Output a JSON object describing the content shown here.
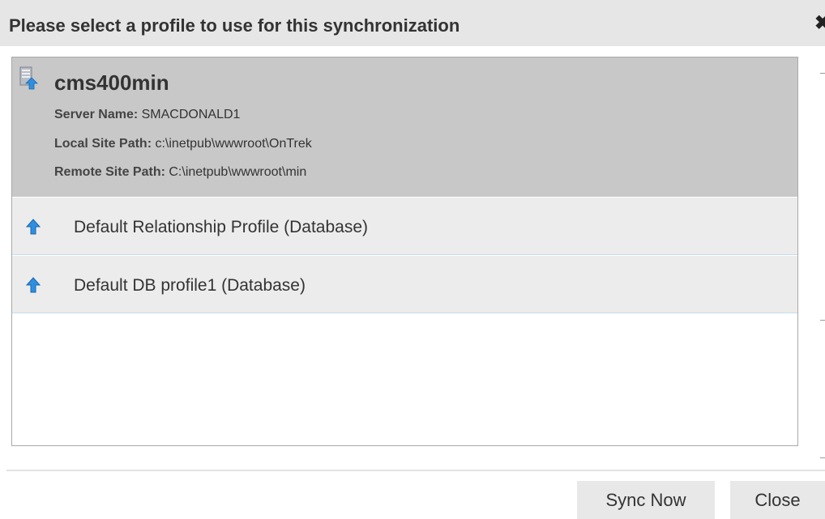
{
  "dialog": {
    "title": "Please select a profile to use for this synchronization",
    "close_glyph": "✖"
  },
  "server": {
    "icon": "server-sync-icon",
    "name": "cms400min",
    "server_name_label": "Server Name:",
    "server_name_value": "SMACDONALD1",
    "local_path_label": "Local Site Path:",
    "local_path_value": "c:\\inetpub\\wwwroot\\OnTrek",
    "remote_path_label": "Remote Site Path:",
    "remote_path_value": "C:\\inetpub\\wwwroot\\min"
  },
  "profiles": [
    {
      "icon": "blue-up-arrow-icon",
      "label": "Default Relationship Profile (Database)"
    },
    {
      "icon": "blue-up-arrow-icon",
      "label": "Default DB profile1 (Database)"
    }
  ],
  "footer": {
    "sync_now_label": "Sync Now",
    "close_label": "Close"
  },
  "colors": {
    "title_bar": "#e6e6e6",
    "server_header": "#c8c8c8",
    "profile_row": "#ececec",
    "arrow": "#2f8fe0",
    "button": "#e8e8e8"
  }
}
